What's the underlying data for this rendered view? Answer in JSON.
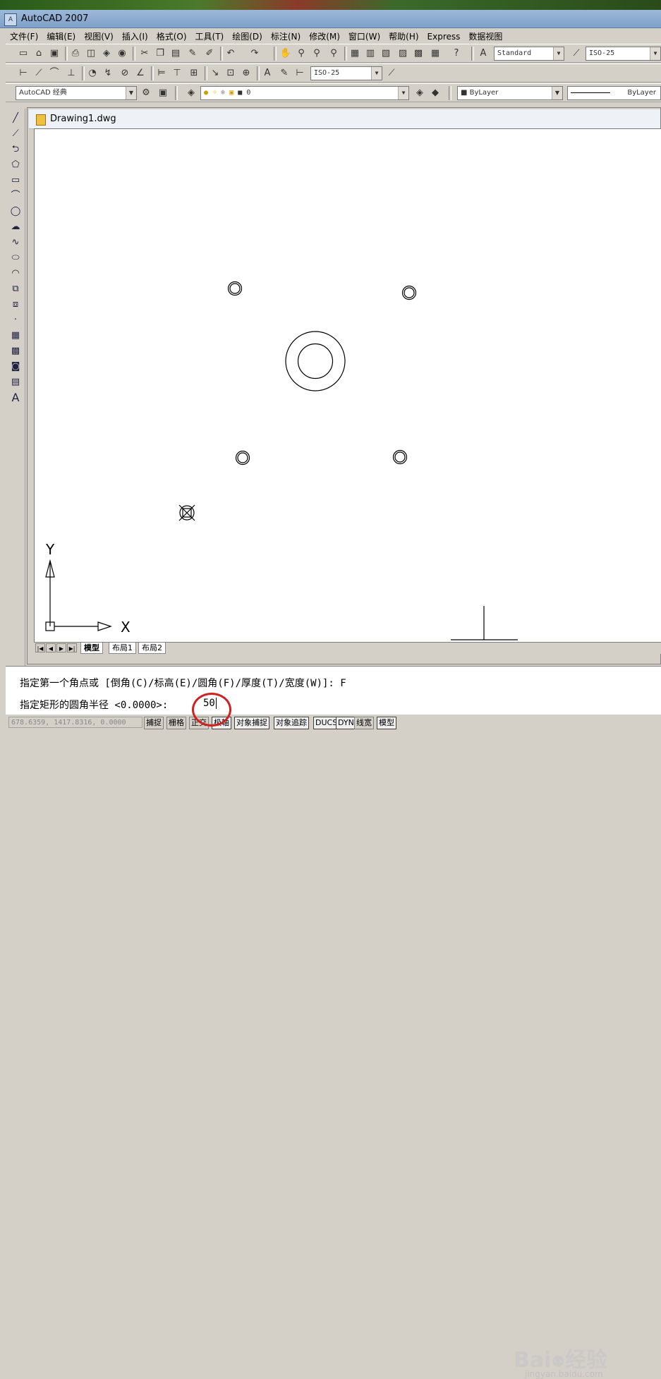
{
  "app": {
    "title": "AutoCAD 2007"
  },
  "menu": [
    "文件(F)",
    "编辑(E)",
    "视图(V)",
    "插入(I)",
    "格式(O)",
    "工具(T)",
    "绘图(D)",
    "标注(N)",
    "修改(M)",
    "窗口(W)",
    "帮助(H)",
    "Express",
    "数据视图"
  ],
  "toolbar": {
    "text_style": "Standard",
    "dim_style_top": "ISO-25",
    "dim_style_row2": "ISO-25",
    "workspace": "AutoCAD 经典",
    "layer": "0",
    "color": "ByLayer",
    "linetype": "ByLayer"
  },
  "document": {
    "name": "Drawing1.dwg"
  },
  "canvas": {
    "axis_x": "X",
    "axis_y": "Y"
  },
  "tabs": [
    "模型",
    "布局1",
    "布局2"
  ],
  "command": {
    "line1": "指定第一个角点或 [倒角(C)/标高(E)/圆角(F)/厚度(T)/宽度(W)]: F",
    "line2": "指定矩形的圆角半径 <0.0000>: ",
    "input_value": "50"
  },
  "status": {
    "coords": "678.6359, 1417.8316, 0.0000",
    "buttons": [
      "捕捉",
      "栅格",
      "正交",
      "极轴",
      "对象捕捉",
      "对象追踪",
      "DUCS",
      "DYN",
      "线宽",
      "模型"
    ]
  },
  "watermark": {
    "brand": "Baidu经验",
    "url": "jingyan.baidu.com"
  },
  "colors": {
    "title_bar": "#9cb8d8",
    "annotation": "#d02020",
    "canvas": "#ffffff"
  }
}
